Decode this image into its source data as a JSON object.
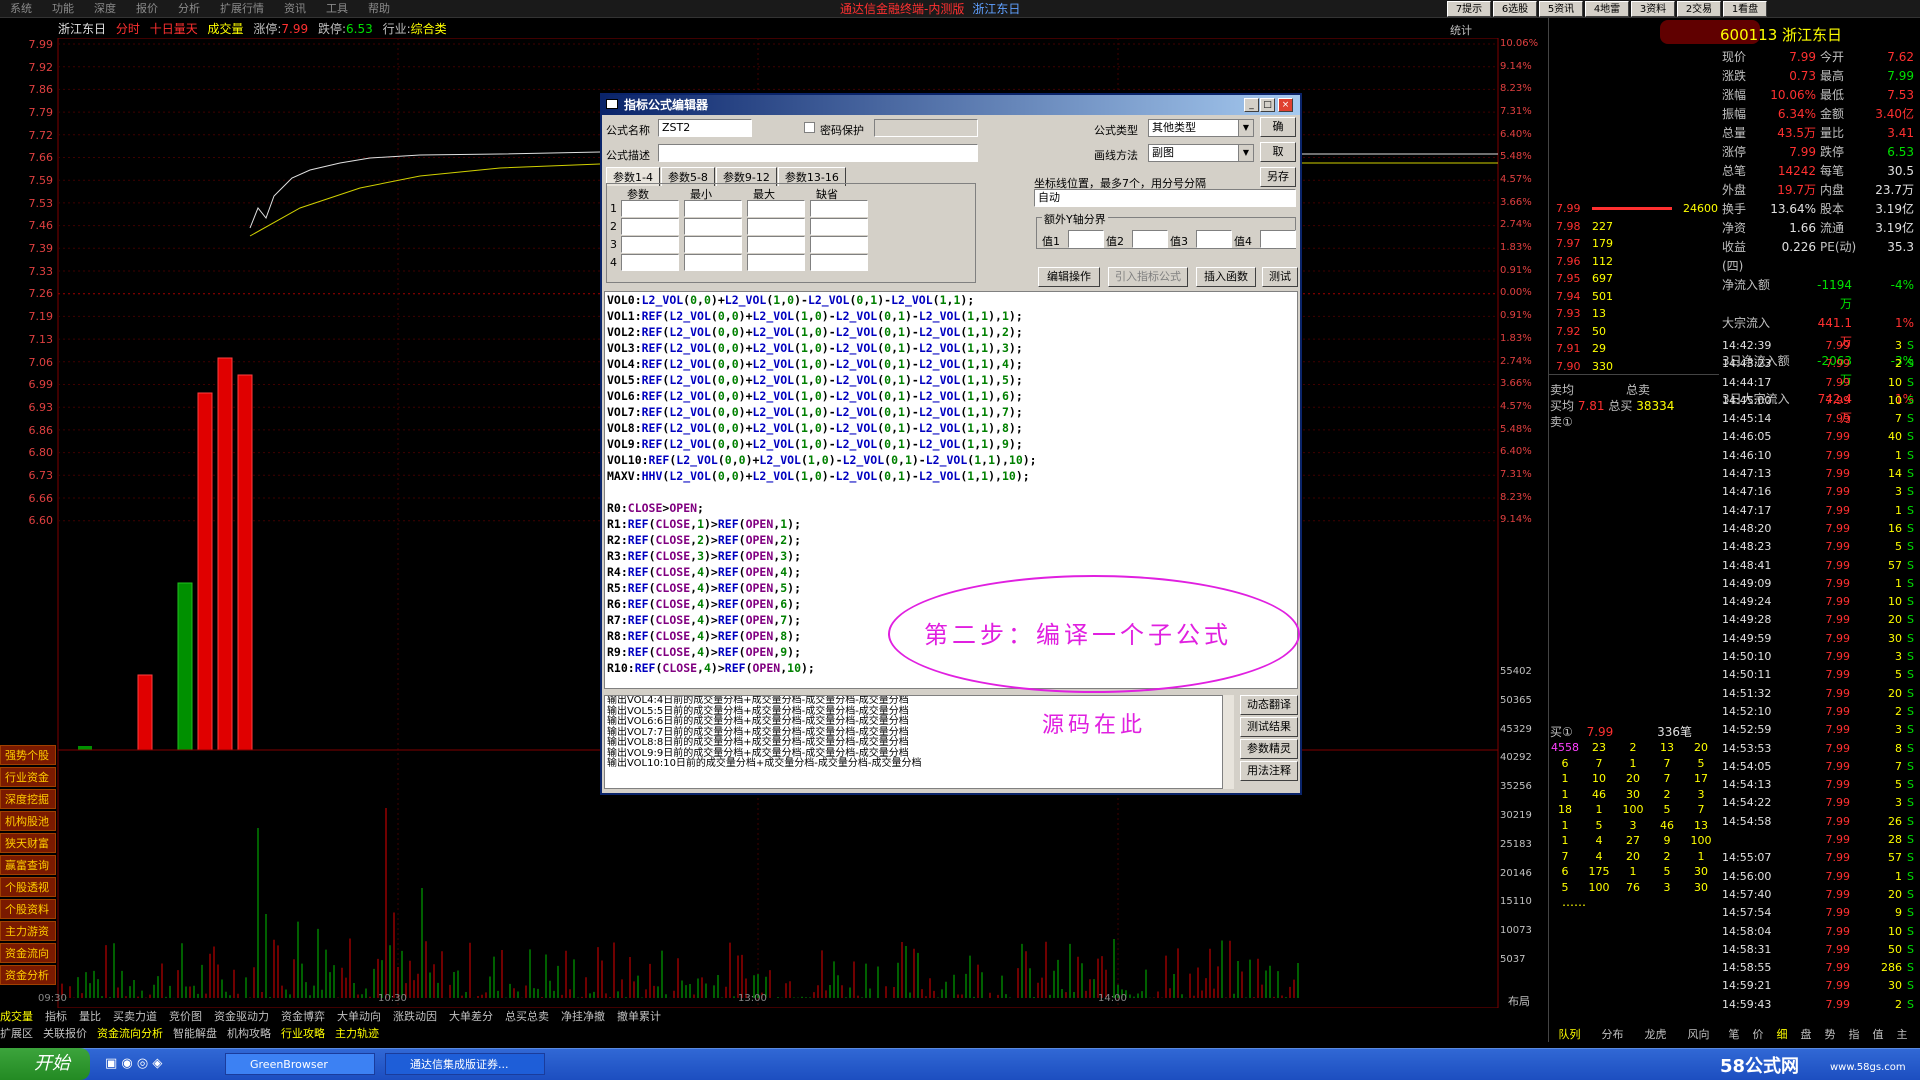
{
  "menu": [
    "系统",
    "功能",
    "深度",
    "报价",
    "分析",
    "扩展行情",
    "资讯",
    "工具",
    "帮助"
  ],
  "app_title": "通达信金融终端-内测版",
  "app_stock": "浙江东日",
  "top_buttons": [
    "7提示",
    "6选股",
    "5资讯",
    "4地雷",
    "3资料",
    "2交易",
    "1看盘"
  ],
  "infobar": {
    "name": "浙江东日",
    "mode": "分时",
    "ten": "十日量天",
    "vol": "成交量",
    "zt_label": "涨停:",
    "zt": "7.99",
    "dt_label": "跌停:",
    "dt": "6.53",
    "ind_label": "行业:",
    "ind": "综合类",
    "stat": "统计"
  },
  "y_left": [
    "7.99",
    "7.92",
    "7.86",
    "7.79",
    "7.72",
    "7.66",
    "7.59",
    "7.53",
    "7.46",
    "7.39",
    "7.33",
    "7.26",
    "7.19",
    "7.13",
    "7.06",
    "6.99",
    "6.93",
    "6.86",
    "6.80",
    "6.73",
    "6.66",
    "6.60"
  ],
  "y_right": [
    "10.06%",
    "9.14%",
    "8.23%",
    "7.31%",
    "6.40%",
    "5.48%",
    "4.57%",
    "3.66%",
    "2.74%",
    "1.83%",
    "0.91%",
    "0.00%",
    "0.91%",
    "1.83%",
    "2.74%",
    "3.66%",
    "4.57%",
    "5.48%",
    "6.40%",
    "7.31%",
    "8.23%",
    "9.14%"
  ],
  "vol_axis": [
    "55402",
    "50365",
    "45329",
    "40292",
    "35256",
    "30219",
    "25183",
    "20146",
    "15110",
    "10073",
    "5037"
  ],
  "time_axis": [
    "09:30",
    "10:30",
    "13:00",
    "14:00"
  ],
  "layout_label": "布局",
  "side_buttons": [
    "强势个股",
    "行业资金",
    "深度挖掘",
    "机构股池",
    "狭天财富",
    "赢富查询",
    "个股透视",
    "个股资料",
    "主力游资",
    "资金流向",
    "资金分析"
  ],
  "subtabs1": [
    "成交量",
    "指标",
    "量比",
    "买卖力道",
    "竞价图",
    "资金驱动力",
    "资金博弈",
    "大单动向",
    "涨跌动因",
    "大单差分",
    "总买总卖",
    "净挂净撤",
    "撤单累计"
  ],
  "subtabs2": [
    "扩展区",
    "关联报价",
    "资金流向分析",
    "智能解盘",
    "机构攻略",
    "行业攻略",
    "主力轨迹"
  ],
  "stock_header": {
    "code": "600113",
    "name": "浙江东日"
  },
  "quote": [
    {
      "k": "现价",
      "v": "7.99",
      "k2": "今开",
      "v2": "7.62"
    },
    {
      "k": "涨跌",
      "v": "0.73",
      "k2": "最高",
      "v2": "7.99"
    },
    {
      "k": "涨幅",
      "v": "10.06%",
      "k2": "最低",
      "v2": "7.53"
    },
    {
      "k": "振幅",
      "v": "6.34%",
      "k2": "金额",
      "v2": "3.40亿"
    },
    {
      "k": "总量",
      "v": "43.5万",
      "k2": "量比",
      "v2": "3.41"
    },
    {
      "k": "涨停",
      "v": "7.99",
      "k2": "跌停",
      "v2": "6.53"
    },
    {
      "k": "总笔",
      "v": "14242",
      "k2": "每笔",
      "v2": "30.5"
    },
    {
      "k": "外盘",
      "v": "19.7万",
      "k2": "内盘",
      "v2": "23.7万"
    },
    {
      "k": "换手",
      "v": "13.64%",
      "k2": "股本",
      "v2": "3.19亿"
    },
    {
      "k": "净资",
      "v": "1.66",
      "k2": "流通",
      "v2": "3.19亿"
    },
    {
      "k": "收益(四)",
      "v": "0.226",
      "k2": "PE(动)",
      "v2": "35.3"
    },
    {
      "k": "净流入额",
      "v": "-1194万",
      "k2": "",
      "v2": "-4%"
    },
    {
      "k": "大宗流入",
      "v": "441.1万",
      "k2": "",
      "v2": "1%"
    },
    {
      "k": "3日净流入额",
      "v": "-2063万",
      "k2": "",
      "v2": "-3%"
    },
    {
      "k": "3日大宗流入",
      "v": "742.4万",
      "k2": "",
      "v2": "1%"
    }
  ],
  "sell_levels": [
    {
      "p": "7.99",
      "v": "24600"
    },
    {
      "p": "7.98",
      "v": "227"
    },
    {
      "p": "7.97",
      "v": "179"
    },
    {
      "p": "7.96",
      "v": "112"
    },
    {
      "p": "7.95",
      "v": "697"
    },
    {
      "p": "7.94",
      "v": "501"
    },
    {
      "p": "7.93",
      "v": "13"
    },
    {
      "p": "7.92",
      "v": "50"
    },
    {
      "p": "7.91",
      "v": "29"
    },
    {
      "p": "7.90",
      "v": "330"
    }
  ],
  "avg": {
    "sell_label": "卖均",
    "buy_label": "买均",
    "buy_val": "7.81",
    "total_sell": "总卖",
    "total_buy": "总买",
    "total_buy_val": "38334",
    "sell1": "卖①"
  },
  "buy1": {
    "label": "买①",
    "p": "7.99",
    "v": "336笔"
  },
  "queue": [
    [
      "4558",
      "23",
      "2",
      "13",
      "20"
    ],
    [
      "6",
      "7",
      "1",
      "7",
      "5"
    ],
    [
      "1",
      "10",
      "20",
      "7",
      "17"
    ],
    [
      "1",
      "46",
      "30",
      "2",
      "3"
    ],
    [
      "18",
      "1",
      "100",
      "5",
      "7"
    ],
    [
      "1",
      "5",
      "3",
      "46",
      "13"
    ],
    [
      "1",
      "4",
      "27",
      "9",
      "100"
    ],
    [
      "7",
      "4",
      "20",
      "2",
      "1"
    ],
    [
      "6",
      "175",
      "1",
      "5",
      "30"
    ],
    [
      "5",
      "100",
      "76",
      "3",
      "30"
    ]
  ],
  "ellipsis": "……",
  "ticks": [
    [
      "14:42:39",
      "7.99",
      "3",
      "S"
    ],
    [
      "14:43:23",
      "7.99",
      "2",
      "S"
    ],
    [
      "14:44:17",
      "7.99",
      "10",
      "S"
    ],
    [
      "14:45:00",
      "7.99",
      "10",
      "S"
    ],
    [
      "14:45:14",
      "7.99",
      "7",
      "S"
    ],
    [
      "14:46:05",
      "7.99",
      "40",
      "S"
    ],
    [
      "14:46:10",
      "7.99",
      "1",
      "S"
    ],
    [
      "14:47:13",
      "7.99",
      "14",
      "S"
    ],
    [
      "14:47:16",
      "7.99",
      "3",
      "S"
    ],
    [
      "14:47:17",
      "7.99",
      "1",
      "S"
    ],
    [
      "14:48:20",
      "7.99",
      "16",
      "S"
    ],
    [
      "14:48:23",
      "7.99",
      "5",
      "S"
    ],
    [
      "14:48:41",
      "7.99",
      "57",
      "S"
    ],
    [
      "14:49:09",
      "7.99",
      "1",
      "S"
    ],
    [
      "14:49:24",
      "7.99",
      "10",
      "S"
    ],
    [
      "14:49:28",
      "7.99",
      "20",
      "S"
    ],
    [
      "14:49:59",
      "7.99",
      "30",
      "S"
    ],
    [
      "14:50:10",
      "7.99",
      "3",
      "S"
    ],
    [
      "14:50:11",
      "7.99",
      "5",
      "S"
    ],
    [
      "14:51:32",
      "7.99",
      "20",
      "S"
    ],
    [
      "14:52:10",
      "7.99",
      "2",
      "S"
    ],
    [
      "14:52:59",
      "7.99",
      "3",
      "S"
    ],
    [
      "14:53:53",
      "7.99",
      "8",
      "S"
    ],
    [
      "14:54:05",
      "7.99",
      "7",
      "S"
    ],
    [
      "14:54:13",
      "7.99",
      "5",
      "S"
    ],
    [
      "14:54:22",
      "7.99",
      "3",
      "S"
    ],
    [
      "14:54:58",
      "7.99",
      "26",
      "S"
    ],
    [
      "",
      "7.99",
      "28",
      "S"
    ],
    [
      "14:55:07",
      "7.99",
      "57",
      "S"
    ],
    [
      "14:56:00",
      "7.99",
      "1",
      "S"
    ],
    [
      "14:57:40",
      "7.99",
      "20",
      "S"
    ],
    [
      "14:57:54",
      "7.99",
      "9",
      "S"
    ],
    [
      "14:58:04",
      "7.99",
      "10",
      "S"
    ],
    [
      "14:58:31",
      "7.99",
      "50",
      "S"
    ],
    [
      "14:58:55",
      "7.99",
      "286",
      "S"
    ],
    [
      "14:59:21",
      "7.99",
      "30",
      "S"
    ],
    [
      "14:59:43",
      "7.99",
      "2",
      "S"
    ]
  ],
  "right_tabs": [
    "队列",
    "分布",
    "龙虎",
    "风向"
  ],
  "right_tabs2": [
    "笔",
    "价",
    "细",
    "盘",
    "势",
    "指",
    "值",
    "主"
  ],
  "taskbar": {
    "start": "开始",
    "t1": "GreenBrowser",
    "t2": "通达信集成版证券...",
    "brand": "58公式网",
    "url": "www.58gs.com"
  },
  "dialog": {
    "title": "指标公式编辑器",
    "name_label": "公式名称",
    "name_val": "ZST2",
    "pwd_label": "密码保护",
    "desc_label": "公式描述",
    "type_label": "公式类型",
    "type_val": "其他类型",
    "draw_label": "画线方法",
    "draw_val": "副图",
    "ok": "确",
    "cancel": "取",
    "saveas": "另存",
    "tabs": [
      "参数1-4",
      "参数5-8",
      "参数9-12",
      "参数13-16"
    ],
    "param_cols": [
      "参数",
      "最小",
      "最大",
      "缺省"
    ],
    "param_rows": [
      "1",
      "2",
      "3",
      "4"
    ],
    "axis_label": "坐标线位置，最多7个，用分号分隔",
    "axis_val": "自动",
    "extra_y": "额外Y轴分界",
    "vals": [
      "值1",
      "值2",
      "值3",
      "值4"
    ],
    "b_edit": "编辑操作",
    "b_import": "引入指标公式",
    "b_insert": "插入函数",
    "b_test": "测试",
    "side_btns": [
      "动态翻译",
      "测试结果",
      "参数精灵",
      "用法注释"
    ],
    "code": [
      "VOL0:L2_VOL(0,0)+L2_VOL(1,0)-L2_VOL(0,1)-L2_VOL(1,1);",
      "VOL1:REF(L2_VOL(0,0)+L2_VOL(1,0)-L2_VOL(0,1)-L2_VOL(1,1),1);",
      "VOL2:REF(L2_VOL(0,0)+L2_VOL(1,0)-L2_VOL(0,1)-L2_VOL(1,1),2);",
      "VOL3:REF(L2_VOL(0,0)+L2_VOL(1,0)-L2_VOL(0,1)-L2_VOL(1,1),3);",
      "VOL4:REF(L2_VOL(0,0)+L2_VOL(1,0)-L2_VOL(0,1)-L2_VOL(1,1),4);",
      "VOL5:REF(L2_VOL(0,0)+L2_VOL(1,0)-L2_VOL(0,1)-L2_VOL(1,1),5);",
      "VOL6:REF(L2_VOL(0,0)+L2_VOL(1,0)-L2_VOL(0,1)-L2_VOL(1,1),6);",
      "VOL7:REF(L2_VOL(0,0)+L2_VOL(1,0)-L2_VOL(0,1)-L2_VOL(1,1),7);",
      "VOL8:REF(L2_VOL(0,0)+L2_VOL(1,0)-L2_VOL(0,1)-L2_VOL(1,1),8);",
      "VOL9:REF(L2_VOL(0,0)+L2_VOL(1,0)-L2_VOL(0,1)-L2_VOL(1,1),9);",
      "VOL10:REF(L2_VOL(0,0)+L2_VOL(1,0)-L2_VOL(0,1)-L2_VOL(1,1),10);",
      "MAXV:HHV(L2_VOL(0,0)+L2_VOL(1,0)-L2_VOL(0,1)-L2_VOL(1,1),10);",
      "",
      "R0:CLOSE>OPEN;",
      "R1:REF(CLOSE,1)>REF(OPEN,1);",
      "R2:REF(CLOSE,2)>REF(OPEN,2);",
      "R3:REF(CLOSE,3)>REF(OPEN,3);",
      "R4:REF(CLOSE,4)>REF(OPEN,4);",
      "R5:REF(CLOSE,4)>REF(OPEN,5);",
      "R6:REF(CLOSE,4)>REF(OPEN,6);",
      "R7:REF(CLOSE,4)>REF(OPEN,7);",
      "R8:REF(CLOSE,4)>REF(OPEN,8);",
      "R9:REF(CLOSE,4)>REF(OPEN,9);",
      "R10:REF(CLOSE,4)>REF(OPEN,10);"
    ],
    "output": [
      "输出VOL4:4日前的成交量分档+成交量分档-成交量分档-成交量分档",
      "输出VOL5:5日前的成交量分档+成交量分档-成交量分档-成交量分档",
      "输出VOL6:6日前的成交量分档+成交量分档-成交量分档-成交量分档",
      "输出VOL7:7日前的成交量分档+成交量分档-成交量分档-成交量分档",
      "输出VOL8:8日前的成交量分档+成交量分档-成交量分档-成交量分档",
      "输出VOL9:9日前的成交量分档+成交量分档-成交量分档-成交量分档",
      "输出VOL10:10日前的成交量分档+成交量分档-成交量分档-成交量分档"
    ],
    "annotation1": "第二步：编译一个子公式",
    "annotation2": "源码在此"
  }
}
